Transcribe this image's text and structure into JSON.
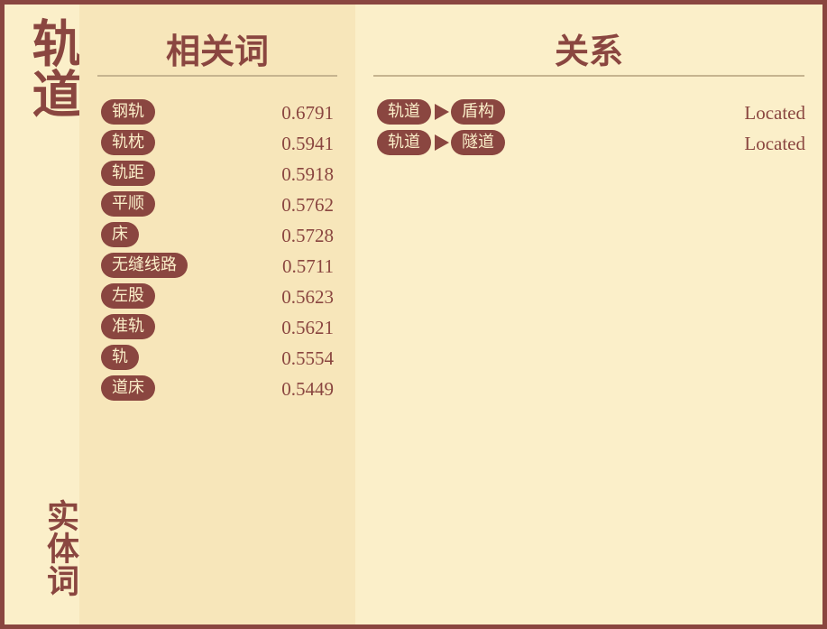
{
  "entity": {
    "title": "轨道",
    "caption": "实体词"
  },
  "related": {
    "heading": "相关词",
    "items": [
      {
        "word": "钢轨",
        "score": "0.6791"
      },
      {
        "word": "轨枕",
        "score": "0.5941"
      },
      {
        "word": "轨距",
        "score": "0.5918"
      },
      {
        "word": "平顺",
        "score": "0.5762"
      },
      {
        "word": "床",
        "score": "0.5728"
      },
      {
        "word": "无缝线路",
        "score": "0.5711"
      },
      {
        "word": "左股",
        "score": "0.5623"
      },
      {
        "word": "准轨",
        "score": "0.5621"
      },
      {
        "word": "轨",
        "score": "0.5554"
      },
      {
        "word": "道床",
        "score": "0.5449"
      }
    ]
  },
  "relations": {
    "heading": "关系",
    "items": [
      {
        "source": "轨道",
        "target": "盾构",
        "type": "Located"
      },
      {
        "source": "轨道",
        "target": "隧道",
        "type": "Located"
      }
    ]
  },
  "colors": {
    "background": "#fbefc9",
    "panel": "#f7e6ba",
    "accent": "#8a4640",
    "rule": "#c6b48f"
  }
}
